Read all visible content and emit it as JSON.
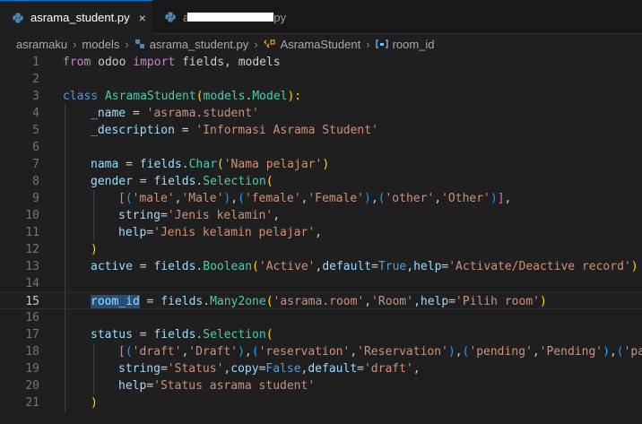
{
  "tabs": [
    {
      "label": "asrama_student.py",
      "close": "×",
      "active": true
    },
    {
      "label": "a",
      "redacted": true,
      "suffix": "py",
      "active": false
    }
  ],
  "breadcrumb": {
    "items": [
      "asramaku",
      "models",
      "asrama_student.py",
      "AsramaStudent",
      "room_id"
    ],
    "separator": "›"
  },
  "editor": {
    "current_line": 15,
    "lines": [
      {
        "n": "1"
      },
      {
        "n": "2"
      },
      {
        "n": "3"
      },
      {
        "n": "4"
      },
      {
        "n": "5"
      },
      {
        "n": "6"
      },
      {
        "n": "7"
      },
      {
        "n": "8"
      },
      {
        "n": "9"
      },
      {
        "n": "10"
      },
      {
        "n": "11"
      },
      {
        "n": "12"
      },
      {
        "n": "13"
      },
      {
        "n": "14"
      },
      {
        "n": "15"
      },
      {
        "n": "16"
      },
      {
        "n": "17"
      },
      {
        "n": "18"
      },
      {
        "n": "19"
      },
      {
        "n": "20"
      },
      {
        "n": "21"
      }
    ],
    "tokens": {
      "l1": [
        "from",
        " odoo ",
        "import",
        " fields, models"
      ],
      "l3": [
        "class",
        " ",
        "AsramaStudent",
        "(",
        "models",
        ".",
        "Model",
        "):"
      ],
      "l4": [
        "_name",
        " = ",
        "'asrama.student'"
      ],
      "l5": [
        "_description",
        " = ",
        "'Informasi Asrama Student'"
      ],
      "l7": [
        "nama",
        " = ",
        "fields",
        ".",
        "Char",
        "(",
        "'Nama pelajar'",
        ")"
      ],
      "l8": [
        "gender",
        " = ",
        "fields",
        ".",
        "Selection",
        "("
      ],
      "l9": [
        "[",
        "(",
        "'male'",
        ",",
        "'Male'",
        ")",
        ",",
        "(",
        "'female'",
        ",",
        "'Female'",
        ")",
        ",",
        "(",
        "'other'",
        ",",
        "'Other'",
        ")",
        "]",
        ","
      ],
      "l10": [
        "string",
        "=",
        "'Jenis kelamin'",
        ","
      ],
      "l11": [
        "help",
        "=",
        "'Jenis kelamin pelajar'",
        ","
      ],
      "l12": [
        ")"
      ],
      "l13": [
        "active",
        " = ",
        "fields",
        ".",
        "Boolean",
        "(",
        "'Active'",
        ",",
        "default",
        "=",
        "True",
        ",",
        "help",
        "=",
        "'Activate/Deactive record'",
        ")"
      ],
      "l15": [
        "room_id",
        " = ",
        "fields",
        ".",
        "Many2one",
        "(",
        "'asrama.room'",
        ",",
        "'Room'",
        ",",
        "help",
        "=",
        "'Pilih room'",
        ")"
      ],
      "l17": [
        "status",
        " = ",
        "fields",
        ".",
        "Selection",
        "("
      ],
      "l18": [
        "[",
        "(",
        "'draft'",
        ",",
        "'Draft'",
        ")",
        ",",
        "(",
        "'reservation'",
        ",",
        "'Reservation'",
        ")",
        ",",
        "(",
        "'pending'",
        ",",
        "'Pending'",
        ")",
        ",",
        "(",
        "'pai"
      ],
      "l19": [
        "string",
        "=",
        "'Status'",
        ",",
        "copy",
        "=",
        "False",
        ",",
        "default",
        "=",
        "'draft'",
        ","
      ],
      "l20": [
        "help",
        "=",
        "'Status asrama student'"
      ],
      "l21": [
        ")"
      ]
    }
  },
  "colors": {
    "background": "#1f1f1f",
    "keyword": "#569cd6",
    "control_keyword": "#c586c0",
    "class": "#4ec9b0",
    "string": "#ce9178",
    "function": "#dcdcaa",
    "variable": "#9cdcfe",
    "selection": "#264f78",
    "active_tab_border": "#0078d4"
  },
  "icons": {
    "python_file": "python-icon",
    "class_symbol": "class-symbol-icon",
    "field_symbol": "field-symbol-icon"
  }
}
